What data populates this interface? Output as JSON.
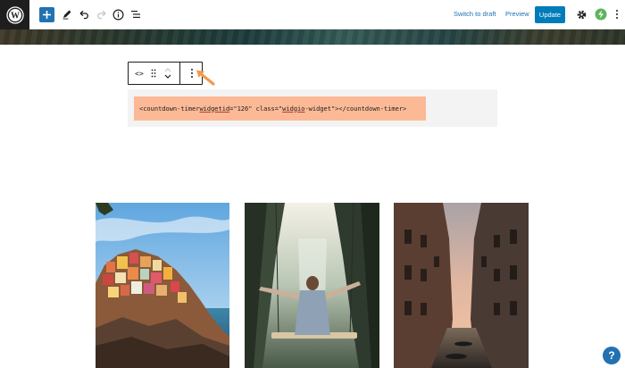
{
  "toolbar": {
    "switch_to_draft": "Switch to draft",
    "preview": "Preview",
    "update": "Update",
    "icons": [
      "wordpress-icon",
      "plus-icon",
      "pencil-icon",
      "undo-icon",
      "redo-icon",
      "info-icon",
      "list-view-icon",
      "gear-icon",
      "plugin-icon",
      "more-vertical-icon"
    ]
  },
  "block_toolbar": {
    "html_glyph": "<>",
    "icons": [
      "code-icon",
      "drag-handle-icon",
      "move-up-icon",
      "move-down-icon",
      "more-vertical-icon"
    ]
  },
  "html_block": {
    "code_prefix": "<countdown-timer ",
    "attr1_name": "widgetid",
    "attr1_rest": "=\"126\" class=\"",
    "attr2_name": "widgio",
    "attr2_rest": "-widget\"></countdown-timer>"
  },
  "gallery": {
    "images": [
      "cliffside-village-photo",
      "woman-on-swing-photo",
      "venice-canal-photo"
    ]
  },
  "help": {
    "label": "?"
  },
  "colors": {
    "accent": "#2271b1",
    "update_button": "#007cba",
    "code_highlight": "#fcb996",
    "arrow": "#f2994a",
    "plugin_green": "#5ab55a"
  }
}
